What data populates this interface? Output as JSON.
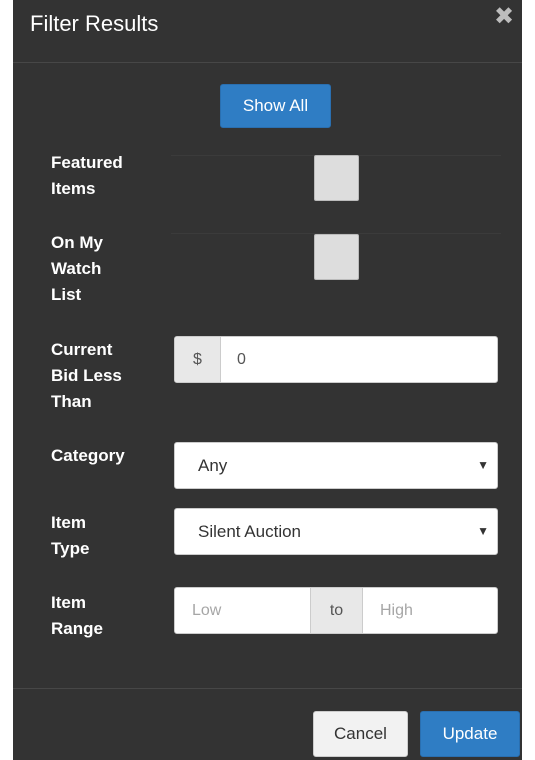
{
  "modal": {
    "title": "Filter Results",
    "close_glyph": "✖",
    "close_icon": "close-icon"
  },
  "show_all_label": "Show All",
  "filters": {
    "featured": {
      "label_lines": [
        "Featured",
        "Items"
      ],
      "checked": false
    },
    "watchlist": {
      "label_lines": [
        "On My",
        "Watch",
        "List"
      ],
      "checked": false
    },
    "current_bid": {
      "label_lines": [
        "Current",
        "Bid Less",
        "Than"
      ],
      "prefix": "$",
      "value": "0"
    },
    "category": {
      "label_lines": [
        "Category"
      ],
      "selected": "Any",
      "caret": "▼"
    },
    "item_type": {
      "label_lines": [
        "Item",
        "Type"
      ],
      "selected": "Silent Auction",
      "caret": "▼"
    },
    "item_range": {
      "label_lines": [
        "Item",
        "Range"
      ],
      "low_placeholder": "Low",
      "separator": "to",
      "high_placeholder": "High"
    }
  },
  "footer": {
    "cancel_label": "Cancel",
    "update_label": "Update"
  },
  "colors": {
    "modal_bg": "#333333",
    "primary": "#2f7dc4"
  }
}
